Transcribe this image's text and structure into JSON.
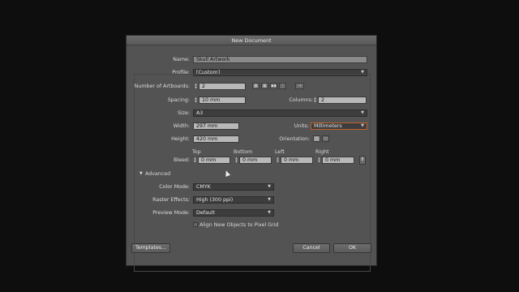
{
  "dialog": {
    "title": "New Document",
    "name_label": "Name:",
    "name_value": "Skull Artwork",
    "profile_label": "Profile:",
    "profile_value": "[Custom]",
    "artboards_label": "Number of Artboards:",
    "artboards_value": "2",
    "spacing_label": "Spacing:",
    "spacing_value": "10 mm",
    "columns_label": "Columns:",
    "columns_value": "2",
    "size_label": "Size:",
    "size_value": "A3",
    "width_label": "Width:",
    "width_value": "297 mm",
    "units_label": "Units:",
    "units_value": "Millimeters",
    "height_label": "Height:",
    "height_value": "420 mm",
    "orientation_label": "Orientation:",
    "bleed_label": "Bleed:",
    "bleed": {
      "top_label": "Top",
      "top_value": "0 mm",
      "bottom_label": "Bottom",
      "bottom_value": "0 mm",
      "left_label": "Left",
      "left_value": "0 mm",
      "right_label": "Right",
      "right_value": "0 mm"
    },
    "advanced_label": "Advanced",
    "color_mode_label": "Color Mode:",
    "color_mode_value": "CMYK",
    "raster_label": "Raster Effects:",
    "raster_value": "High (300 ppi)",
    "preview_label": "Preview Mode:",
    "preview_value": "Default",
    "align_label": "Align New Objects to Pixel Grid",
    "templates_button": "Templates...",
    "cancel_button": "Cancel",
    "ok_button": "OK"
  },
  "icons": {
    "artboard_arrange": [
      "grid-by-row-icon",
      "grid-by-column-icon",
      "arrange-by-row-icon",
      "arrange-by-column-icon",
      "right-to-left-icon"
    ],
    "orientation": [
      "portrait-icon",
      "landscape-icon"
    ],
    "link_bleed": "chain-link-icon"
  },
  "colors": {
    "units_focus_border": "#c0602c"
  }
}
